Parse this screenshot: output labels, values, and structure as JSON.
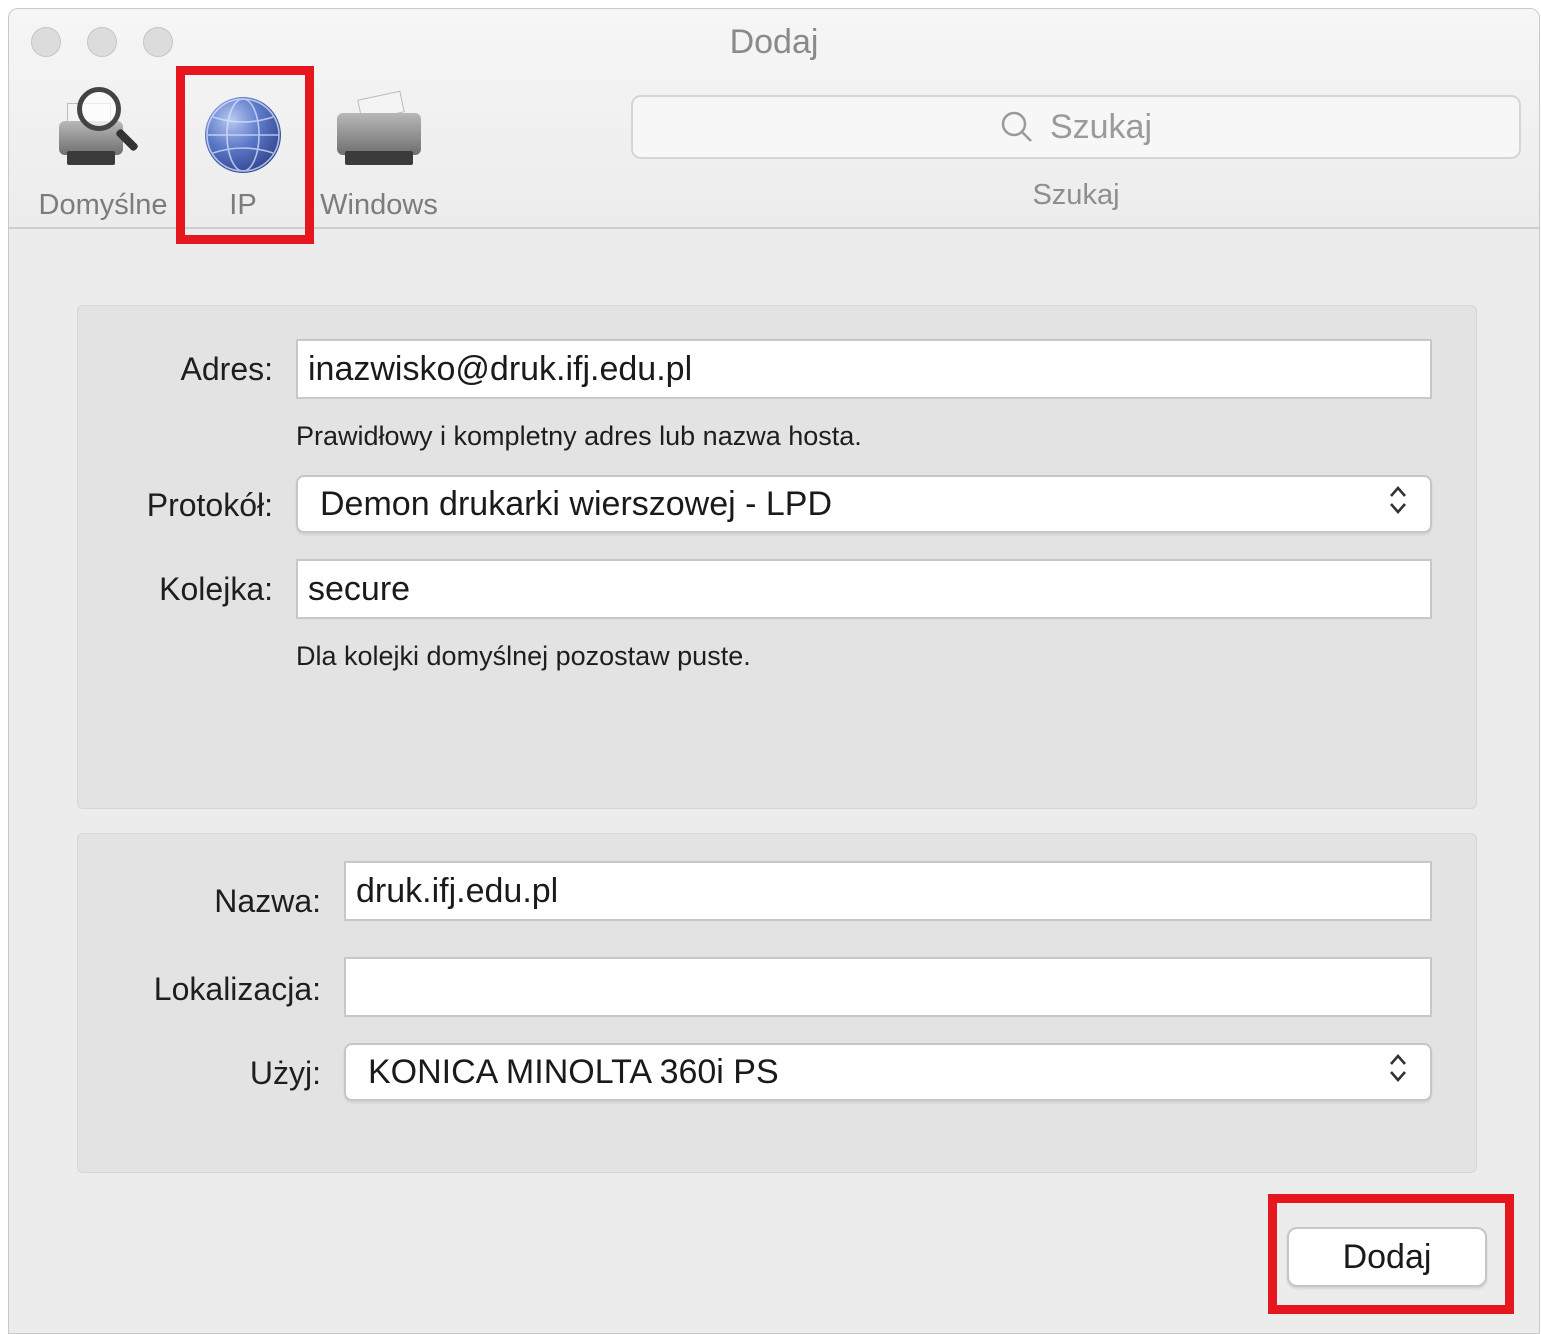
{
  "window": {
    "title": "Dodaj"
  },
  "toolbar": {
    "items": [
      {
        "label": "Domyślne",
        "icon": "printer-magnifier-icon"
      },
      {
        "label": "IP",
        "icon": "globe-icon"
      },
      {
        "label": "Windows",
        "icon": "printer-icon"
      }
    ],
    "search": {
      "placeholder": "Szukaj",
      "label": "Szukaj"
    }
  },
  "connection": {
    "address_label": "Adres:",
    "address_value": "inazwisko@druk.ifj.edu.pl",
    "address_hint": "Prawidłowy i kompletny adres lub nazwa hosta.",
    "protocol_label": "Protokół:",
    "protocol_value": "Demon drukarki wierszowej - LPD",
    "queue_label": "Kolejka:",
    "queue_value": "secure",
    "queue_hint": "Dla kolejki domyślnej pozostaw puste."
  },
  "printer": {
    "name_label": "Nazwa:",
    "name_value": "druk.ifj.edu.pl",
    "location_label": "Lokalizacja:",
    "location_value": "",
    "use_label": "Użyj:",
    "use_value": "KONICA MINOLTA 360i PS"
  },
  "actions": {
    "add_label": "Dodaj"
  },
  "colors": {
    "highlight": "#e5161d"
  }
}
